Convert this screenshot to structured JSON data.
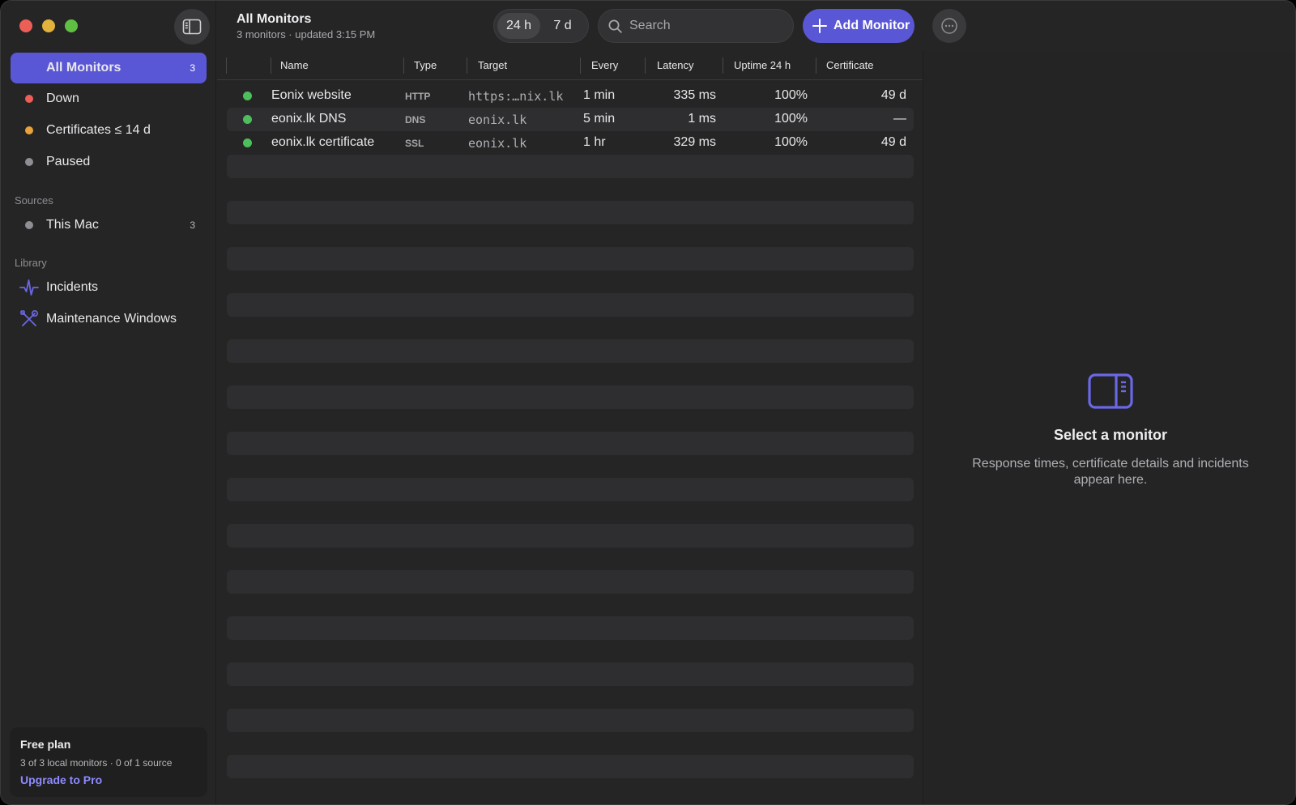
{
  "toolbar": {
    "title": "All Monitors",
    "subtitle": "3 monitors · updated 3:15 PM",
    "range_24h": "24 h",
    "range_7d": "7 d",
    "search_placeholder": "Search",
    "add_label": "Add Monitor"
  },
  "sidebar": {
    "items": [
      {
        "label": "All Monitors",
        "count": "3"
      },
      {
        "label": "Down",
        "color": "#ec5f57"
      },
      {
        "label": "Certificates ≤ 14 d",
        "color": "#e8a33a"
      },
      {
        "label": "Paused",
        "color": "#8e8e93"
      }
    ],
    "sources_head": "Sources",
    "sources": [
      {
        "label": "This Mac",
        "count": "3",
        "color": "#8e8e93"
      }
    ],
    "library_head": "Library",
    "library": [
      {
        "label": "Incidents",
        "icon": "waveform-icon"
      },
      {
        "label": "Maintenance Windows",
        "icon": "tools-icon"
      }
    ]
  },
  "plan": {
    "title": "Free plan",
    "detail": "3 of 3 local monitors · 0 of 1 source",
    "upgrade": "Upgrade to Pro"
  },
  "table": {
    "columns": [
      "Name",
      "Type",
      "Target",
      "Every",
      "Latency",
      "Uptime 24 h",
      "Certificate"
    ],
    "rows": [
      {
        "name": "Eonix website",
        "type": "HTTP",
        "target": "https:…nix.lk",
        "every": "1 min",
        "latency": "335 ms",
        "uptime": "100%",
        "cert": "49 d",
        "status": "up"
      },
      {
        "name": "eonix.lk DNS",
        "type": "DNS",
        "target": "eonix.lk",
        "every": "5 min",
        "latency": "1 ms",
        "uptime": "100%",
        "cert": "—",
        "status": "up"
      },
      {
        "name": "eonix.lk certificate",
        "type": "SSL",
        "target": "eonix.lk",
        "every": "1 hr",
        "latency": "329 ms",
        "uptime": "100%",
        "cert": "49 d",
        "status": "up"
      }
    ]
  },
  "detail": {
    "title": "Select a monitor",
    "description": "Response times, certificate details and incidents appear here."
  },
  "colors": {
    "accent": "#5a57d6",
    "up": "#4cbe5b",
    "link": "#8e8bff"
  }
}
